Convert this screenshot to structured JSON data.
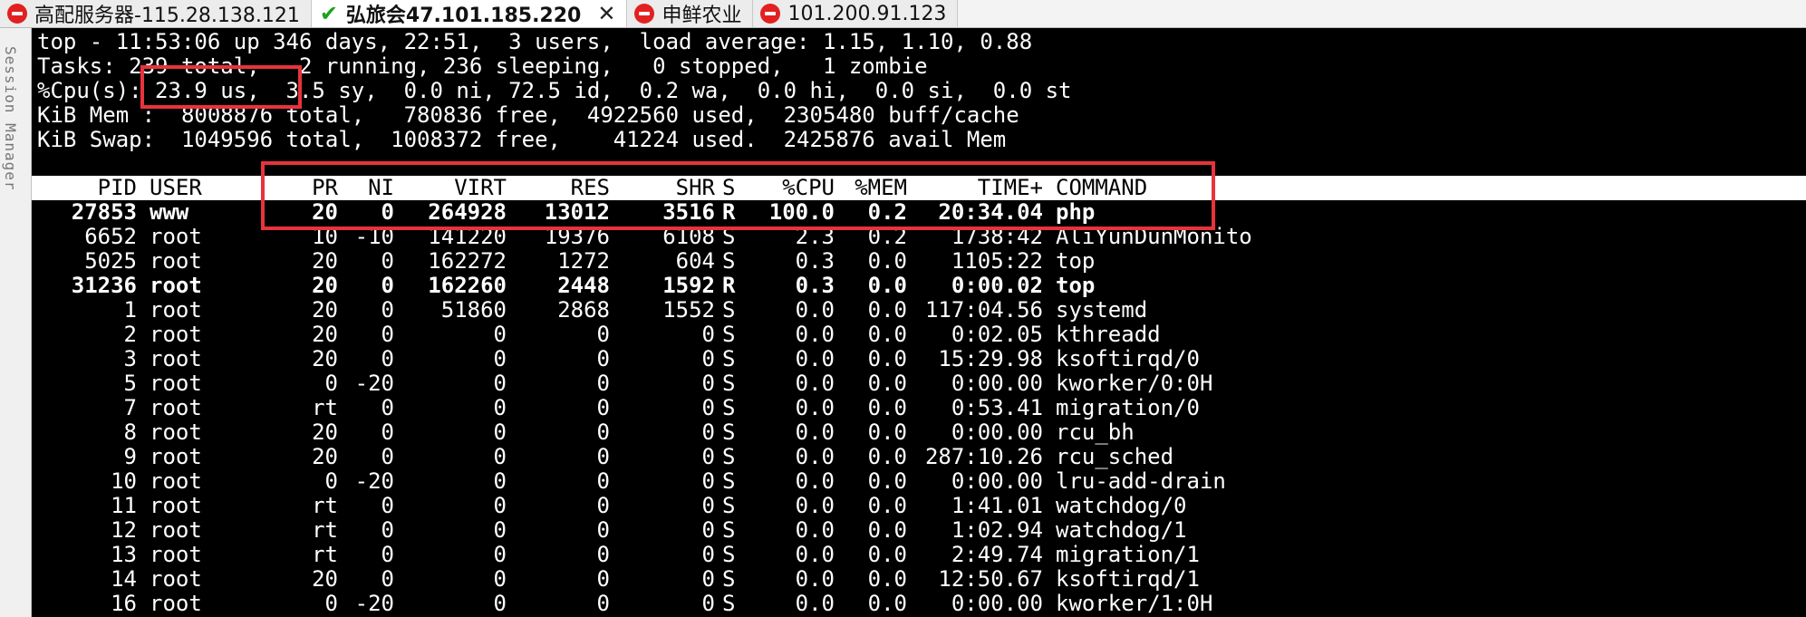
{
  "tabs": [
    {
      "label": "高配服务器-115.28.138.121",
      "status_icon": "stop-icon",
      "active": false
    },
    {
      "label": "弘旅会47.101.185.220",
      "status_icon": "check-icon",
      "active": true,
      "close": "✕"
    },
    {
      "label": "申鲜农业",
      "status_icon": "stop-icon",
      "active": false
    },
    {
      "label": "101.200.91.123",
      "status_icon": "stop-icon",
      "active": false
    }
  ],
  "rail": {
    "label": "Session Manager"
  },
  "summary": {
    "line1": "top - 11:53:06 up 346 days, 22:51,  3 users,  load average: 1.15, 1.10, 0.88",
    "line2": "Tasks: 239 total,   2 running, 236 sleeping,   0 stopped,   1 zombie",
    "line3": "%Cpu(s): 23.9 us,  3.5 sy,  0.0 ni, 72.5 id,  0.2 wa,  0.0 hi,  0.0 si,  0.0 st",
    "line4": "KiB Mem :  8008876 total,   780836 free,  4922560 used,  2305480 buff/cache",
    "line5": "KiB Swap:  1049596 total,  1008372 free,    41224 used.  2425876 avail Mem"
  },
  "columns": [
    "PID",
    "USER",
    "PR",
    "NI",
    "VIRT",
    "RES",
    "SHR",
    "S",
    "%CPU",
    "%MEM",
    "TIME+",
    "COMMAND"
  ],
  "processes": [
    {
      "pid": "27853",
      "user": "www",
      "pr": "20",
      "ni": "0",
      "virt": "264928",
      "res": "13012",
      "shr": "3516",
      "s": "R",
      "cpu": "100.0",
      "mem": "0.2",
      "time": "20:34.04",
      "cmd": "php",
      "bold": true
    },
    {
      "pid": "6652",
      "user": "root",
      "pr": "10",
      "ni": "-10",
      "virt": "141220",
      "res": "19376",
      "shr": "6108",
      "s": "S",
      "cpu": "2.3",
      "mem": "0.2",
      "time": "1738:42",
      "cmd": "AliYunDunMonito",
      "bold": false
    },
    {
      "pid": "5025",
      "user": "root",
      "pr": "20",
      "ni": "0",
      "virt": "162272",
      "res": "1272",
      "shr": "604",
      "s": "S",
      "cpu": "0.3",
      "mem": "0.0",
      "time": "1105:22",
      "cmd": "top",
      "bold": false
    },
    {
      "pid": "31236",
      "user": "root",
      "pr": "20",
      "ni": "0",
      "virt": "162260",
      "res": "2448",
      "shr": "1592",
      "s": "R",
      "cpu": "0.3",
      "mem": "0.0",
      "time": "0:00.02",
      "cmd": "top",
      "bold": true
    },
    {
      "pid": "1",
      "user": "root",
      "pr": "20",
      "ni": "0",
      "virt": "51860",
      "res": "2868",
      "shr": "1552",
      "s": "S",
      "cpu": "0.0",
      "mem": "0.0",
      "time": "117:04.56",
      "cmd": "systemd",
      "bold": false
    },
    {
      "pid": "2",
      "user": "root",
      "pr": "20",
      "ni": "0",
      "virt": "0",
      "res": "0",
      "shr": "0",
      "s": "S",
      "cpu": "0.0",
      "mem": "0.0",
      "time": "0:02.05",
      "cmd": "kthreadd",
      "bold": false
    },
    {
      "pid": "3",
      "user": "root",
      "pr": "20",
      "ni": "0",
      "virt": "0",
      "res": "0",
      "shr": "0",
      "s": "S",
      "cpu": "0.0",
      "mem": "0.0",
      "time": "15:29.98",
      "cmd": "ksoftirqd/0",
      "bold": false
    },
    {
      "pid": "5",
      "user": "root",
      "pr": "0",
      "ni": "-20",
      "virt": "0",
      "res": "0",
      "shr": "0",
      "s": "S",
      "cpu": "0.0",
      "mem": "0.0",
      "time": "0:00.00",
      "cmd": "kworker/0:0H",
      "bold": false
    },
    {
      "pid": "7",
      "user": "root",
      "pr": "rt",
      "ni": "0",
      "virt": "0",
      "res": "0",
      "shr": "0",
      "s": "S",
      "cpu": "0.0",
      "mem": "0.0",
      "time": "0:53.41",
      "cmd": "migration/0",
      "bold": false
    },
    {
      "pid": "8",
      "user": "root",
      "pr": "20",
      "ni": "0",
      "virt": "0",
      "res": "0",
      "shr": "0",
      "s": "S",
      "cpu": "0.0",
      "mem": "0.0",
      "time": "0:00.00",
      "cmd": "rcu_bh",
      "bold": false
    },
    {
      "pid": "9",
      "user": "root",
      "pr": "20",
      "ni": "0",
      "virt": "0",
      "res": "0",
      "shr": "0",
      "s": "S",
      "cpu": "0.0",
      "mem": "0.0",
      "time": "287:10.26",
      "cmd": "rcu_sched",
      "bold": false
    },
    {
      "pid": "10",
      "user": "root",
      "pr": "0",
      "ni": "-20",
      "virt": "0",
      "res": "0",
      "shr": "0",
      "s": "S",
      "cpu": "0.0",
      "mem": "0.0",
      "time": "0:00.00",
      "cmd": "lru-add-drain",
      "bold": false
    },
    {
      "pid": "11",
      "user": "root",
      "pr": "rt",
      "ni": "0",
      "virt": "0",
      "res": "0",
      "shr": "0",
      "s": "S",
      "cpu": "0.0",
      "mem": "0.0",
      "time": "1:41.01",
      "cmd": "watchdog/0",
      "bold": false
    },
    {
      "pid": "12",
      "user": "root",
      "pr": "rt",
      "ni": "0",
      "virt": "0",
      "res": "0",
      "shr": "0",
      "s": "S",
      "cpu": "0.0",
      "mem": "0.0",
      "time": "1:02.94",
      "cmd": "watchdog/1",
      "bold": false
    },
    {
      "pid": "13",
      "user": "root",
      "pr": "rt",
      "ni": "0",
      "virt": "0",
      "res": "0",
      "shr": "0",
      "s": "S",
      "cpu": "0.0",
      "mem": "0.0",
      "time": "2:49.74",
      "cmd": "migration/1",
      "bold": false
    },
    {
      "pid": "14",
      "user": "root",
      "pr": "20",
      "ni": "0",
      "virt": "0",
      "res": "0",
      "shr": "0",
      "s": "S",
      "cpu": "0.0",
      "mem": "0.0",
      "time": "12:50.67",
      "cmd": "ksoftirqd/1",
      "bold": false
    },
    {
      "pid": "16",
      "user": "root",
      "pr": "0",
      "ni": "-20",
      "virt": "0",
      "res": "0",
      "shr": "0",
      "s": "S",
      "cpu": "0.0",
      "mem": "0.0",
      "time": "0:00.00",
      "cmd": "kworker/1:0H",
      "bold": false
    }
  ],
  "colors": {
    "terminal_bg": "#000000",
    "terminal_fg": "#ffffff",
    "highlight": "#e8333b"
  }
}
